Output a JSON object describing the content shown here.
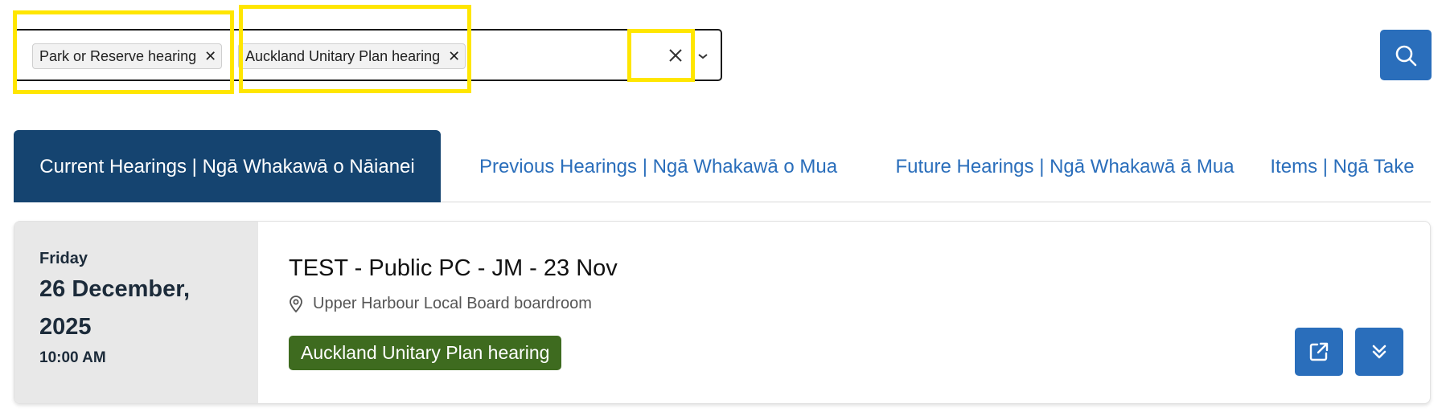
{
  "filters": {
    "chips": [
      {
        "label": "Park or Reserve hearing"
      },
      {
        "label": "Auckland Unitary Plan hearing"
      }
    ]
  },
  "tabs": [
    {
      "label": "Current Hearings | Ngā Whakawā o Nāianei",
      "active": true
    },
    {
      "label": "Previous Hearings | Ngā Whakawā o Mua",
      "active": false
    },
    {
      "label": "Future Hearings | Ngā Whakawā ā Mua",
      "active": false
    },
    {
      "label": "Items | Ngā Take",
      "active": false
    }
  ],
  "hearing": {
    "weekday": "Friday",
    "date": "26 December, 2025",
    "time": "10:00 AM",
    "title": "TEST - Public PC - JM - 23 Nov",
    "location": "Upper Harbour Local Board boardroom",
    "type_badge": "Auckland Unitary Plan hearing"
  },
  "icons": {
    "chip_remove": "close-icon",
    "clear_all": "close-icon",
    "dropdown": "chevron-down-icon",
    "search": "search-icon",
    "location": "map-pin-icon",
    "open_link": "external-link-icon",
    "expand": "double-chevron-down-icon"
  },
  "colors": {
    "primary": "#2a6ebb",
    "active_tab": "#154470",
    "badge": "#3e6b1f",
    "highlight": "#ffe600",
    "date_panel": "#e8e8e8"
  }
}
